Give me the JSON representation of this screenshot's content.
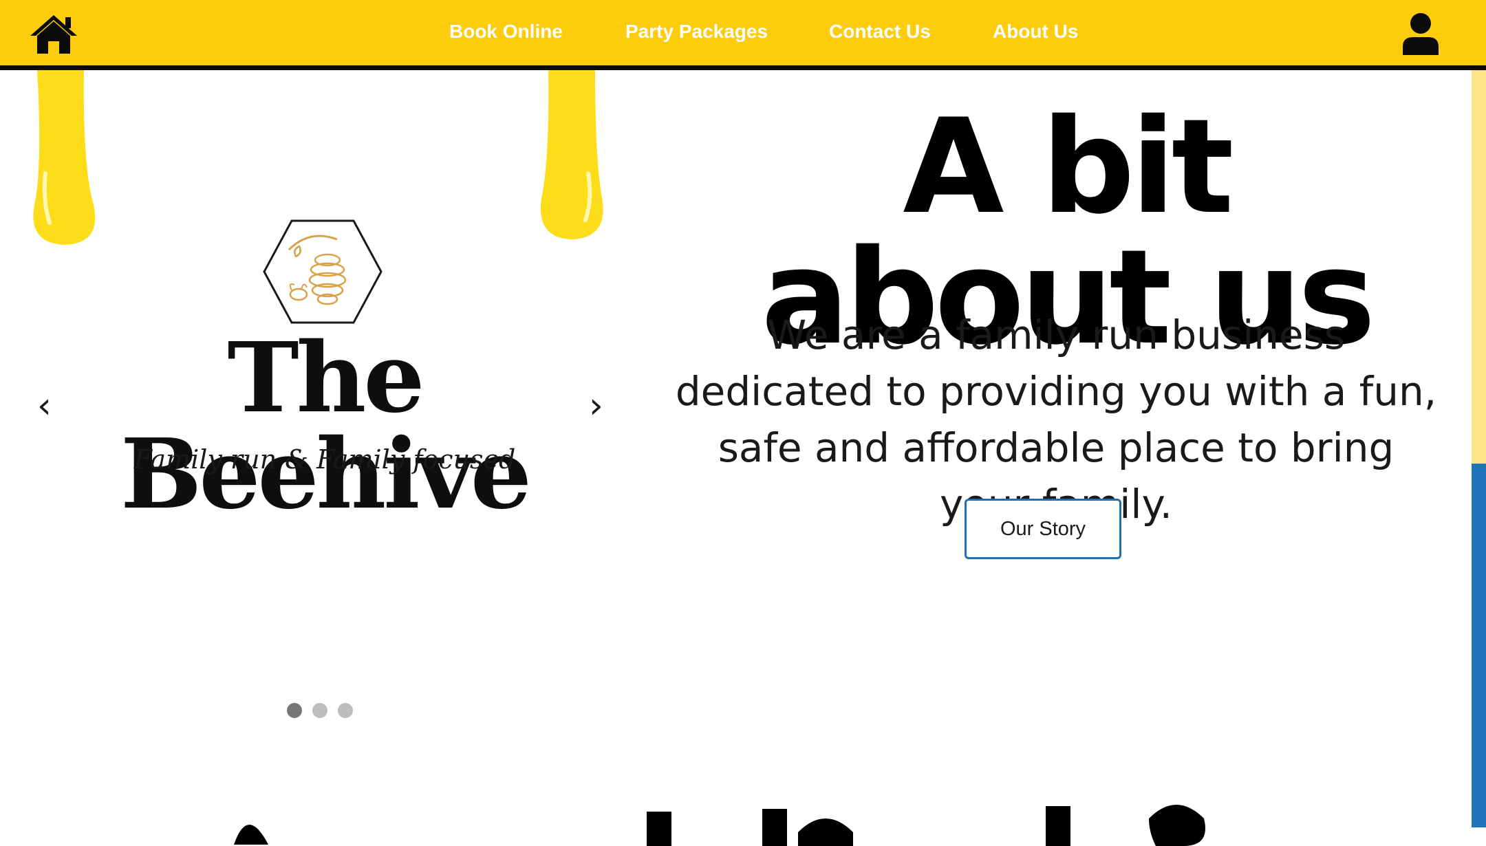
{
  "nav": {
    "links": [
      {
        "label": "Book Online"
      },
      {
        "label": "Party Packages"
      },
      {
        "label": "Contact Us"
      },
      {
        "label": "About Us"
      }
    ],
    "home_icon": "home-icon",
    "user_icon": "user-icon"
  },
  "slider": {
    "brand_name": "The Beehive",
    "tagline": "Family run & Family focused",
    "prev_arrow": "‹",
    "next_arrow": "›",
    "slide_count": 3,
    "active_slide": 1
  },
  "about": {
    "title": "A bit about us",
    "text": "We are a family run business dedicated to providing you with a fun, safe and affordable place to bring your family.",
    "button_label": "Our Story"
  },
  "colors": {
    "brand_yellow": "#fdcc0d",
    "accent_blue": "#1f6fb2",
    "text": "#000000"
  }
}
